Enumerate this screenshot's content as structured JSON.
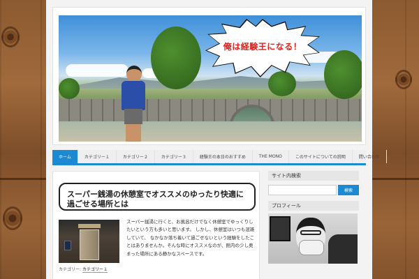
{
  "banner": {
    "speech_text": "俺は経験王になる！"
  },
  "nav": {
    "items": [
      {
        "label": "ホーム",
        "active": true
      },
      {
        "label": "カテゴリー１"
      },
      {
        "label": "カテゴリー２"
      },
      {
        "label": "カテゴリー３"
      },
      {
        "label": "経験王の本日のおすすめ"
      },
      {
        "label": "THE MONO"
      },
      {
        "label": "このサイトについての説明"
      },
      {
        "label": "問い合わせ"
      }
    ],
    "accent_color": "#1b8ad3"
  },
  "post": {
    "title": "スーパー銭湯の休憩室でオススメのゆったり快適に過ごせる場所とは",
    "excerpt": "スーパー銭湯に行くと、お風呂だけでなく休憩室でゆっくりしたいという方も多いと思います。 しかし、休憩室はいつも混雑していて、 なかなか落ち着いて過ごせないという経験をしたことはありませんか。そんな時にオススメなのが、館内の少し奥まった場所にある静かなスペースです。",
    "meta_label": "カテゴリー:",
    "meta_value": "カテゴリー１"
  },
  "sidebar": {
    "search_title": "サイト内検索",
    "search_placeholder": "",
    "search_button": "検索",
    "profile_title": "プロフィール"
  }
}
